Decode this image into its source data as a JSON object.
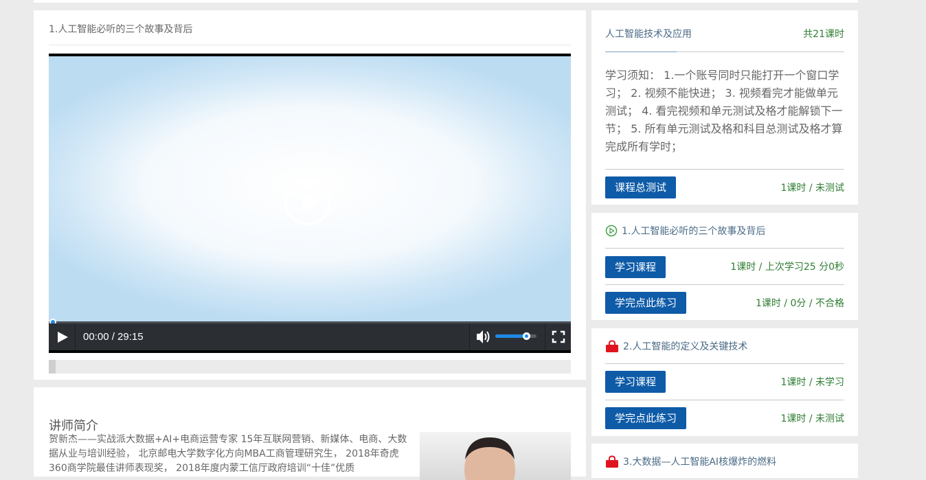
{
  "video": {
    "title": "1.人工智能必听的三个故事及背后",
    "time": "00:00 / 29:15",
    "volume": 0.75
  },
  "teacher": {
    "heading": "讲师简介",
    "bio": "贺新杰——实战派大数据+AI+电商运营专家 15年互联网营销、新媒体、电商、大数据从业与培训经验， 北京邮电大学数字化方向MBA工商管理研究生， 2018年奇虎360商学院最佳讲师表现奖， 2018年度内蒙工信厅政府培训“十佳”优质"
  },
  "course": {
    "name": "人工智能技术及应用",
    "total": "共21课时",
    "notice": "学习须知： 1.一个账号同时只能打开一个窗口学习； 2. 视频不能快进； 3. 视频看完才能做单元测试； 4. 看完视频和单元测试及格才能解锁下一节； 5. 所有单元测试及格和科目总测试及格才算完成所有学时；",
    "final_test_label": "课程总测试",
    "final_test_meta": "1课时 / 未测试"
  },
  "lessons": [
    {
      "title": "1.人工智能必听的三个故事及背后",
      "icon": "play-circle-icon",
      "study_label": "学习课程",
      "study_meta": "1课时 / 上次学习25 分0秒",
      "practice_label": "学完点此练习",
      "practice_meta": "1课时 / 0分 / 不合格"
    },
    {
      "title": "2.人工智能的定义及关键技术",
      "icon": "lock-icon",
      "study_label": "学习课程",
      "study_meta": "1课时 / 未学习",
      "practice_label": "学完点此练习",
      "practice_meta": "1课时 / 未测试"
    },
    {
      "title": "3.大数据—人工智能AI核爆炸的燃料",
      "icon": "lock-icon"
    }
  ],
  "colors": {
    "accent_button": "#0e5ba8",
    "status_green": "#2e7d32",
    "lock_red": "#e0141e",
    "player_blue": "#1e88e5"
  }
}
